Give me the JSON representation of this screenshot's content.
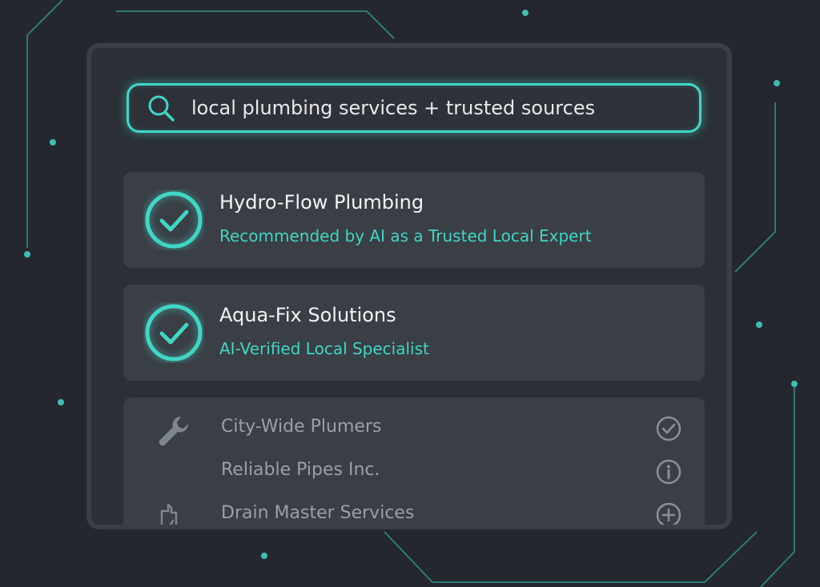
{
  "search": {
    "query": "local plumbing services + trusted sources",
    "icon": "search-icon"
  },
  "results": {
    "featured": [
      {
        "title": "Hydro-Flow Plumbing",
        "subtitle": "Recommended by AI as a Trusted Local Expert",
        "icon": "check-circle-icon"
      },
      {
        "title": "Aqua-Fix Solutions",
        "subtitle": "AI-Verified Local Specialist",
        "icon": "check-circle-icon"
      }
    ],
    "others": [
      {
        "label": "City-Wide Plumers",
        "left_icon": "wrench-icon",
        "right_icon": "check-circle-outline-icon"
      },
      {
        "label": "Reliable Pipes Inc.",
        "left_icon": "",
        "right_icon": "info-circle-icon"
      },
      {
        "label": "Drain Master Services",
        "left_icon": "document-check-icon",
        "right_icon": "plus-circle-icon"
      }
    ]
  },
  "colors": {
    "background": "#24272d",
    "panel": "#2c3036",
    "card": "#3a3e45",
    "accent": "#41d6c4",
    "text_primary": "#f2f4f6",
    "text_muted": "#9aa0a7"
  }
}
